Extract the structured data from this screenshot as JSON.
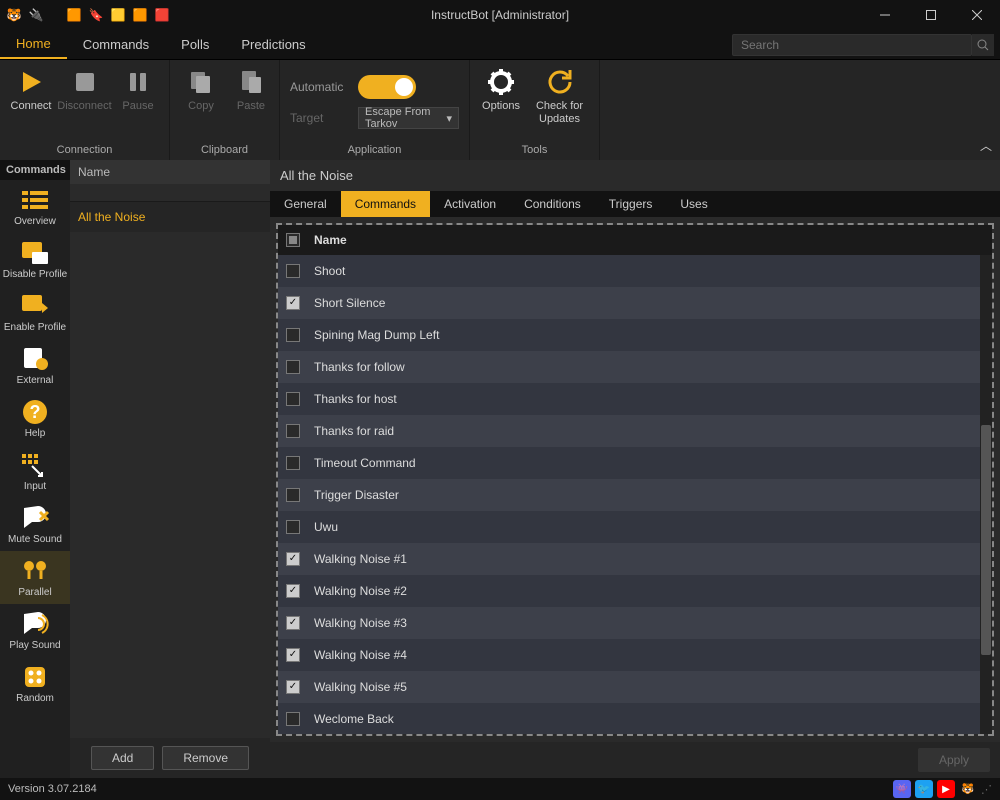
{
  "window": {
    "title": "InstructBot [Administrator]"
  },
  "menu": {
    "items": [
      "Home",
      "Commands",
      "Polls",
      "Predictions"
    ],
    "active": 0
  },
  "search": {
    "placeholder": "Search"
  },
  "ribbon": {
    "connection": {
      "label": "Connection",
      "connect": "Connect",
      "disconnect": "Disconnect",
      "pause": "Pause"
    },
    "clipboard": {
      "label": "Clipboard",
      "copy": "Copy",
      "paste": "Paste"
    },
    "application": {
      "label": "Application",
      "automatic": "Automatic",
      "target": "Target",
      "target_value": "Escape From Tarkov"
    },
    "tools": {
      "label": "Tools",
      "options": "Options",
      "updates": "Check for Updates"
    }
  },
  "rail": {
    "header": "Commands",
    "items": [
      {
        "label": "Overview"
      },
      {
        "label": "Disable Profile"
      },
      {
        "label": "Enable Profile"
      },
      {
        "label": "External"
      },
      {
        "label": "Help"
      },
      {
        "label": "Input"
      },
      {
        "label": "Mute Sound"
      },
      {
        "label": "Parallel"
      },
      {
        "label": "Play Sound"
      },
      {
        "label": "Random"
      }
    ],
    "active": 7
  },
  "name_col": {
    "header": "Name",
    "items": [
      "All the Noise"
    ],
    "add": "Add",
    "remove": "Remove"
  },
  "content": {
    "title": "All the Noise",
    "tabs": [
      "General",
      "Commands",
      "Activation",
      "Conditions",
      "Triggers",
      "Uses"
    ],
    "active_tab": 1,
    "table_header": "Name",
    "rows": [
      {
        "name": "Shoot",
        "checked": false
      },
      {
        "name": "Short Silence",
        "checked": true
      },
      {
        "name": "Spining Mag Dump Left",
        "checked": false
      },
      {
        "name": "Thanks for follow",
        "checked": false
      },
      {
        "name": "Thanks for host",
        "checked": false
      },
      {
        "name": "Thanks for raid",
        "checked": false
      },
      {
        "name": "Timeout Command",
        "checked": false
      },
      {
        "name": "Trigger Disaster",
        "checked": false
      },
      {
        "name": "Uwu",
        "checked": false
      },
      {
        "name": "Walking Noise #1",
        "checked": true
      },
      {
        "name": "Walking Noise #2",
        "checked": true
      },
      {
        "name": "Walking Noise #3",
        "checked": true
      },
      {
        "name": "Walking Noise #4",
        "checked": true
      },
      {
        "name": "Walking Noise #5",
        "checked": true
      },
      {
        "name": "Weclome Back",
        "checked": false
      }
    ],
    "apply": "Apply"
  },
  "status": {
    "version": "Version 3.07.2184"
  },
  "colors": {
    "accent": "#f0b020"
  }
}
